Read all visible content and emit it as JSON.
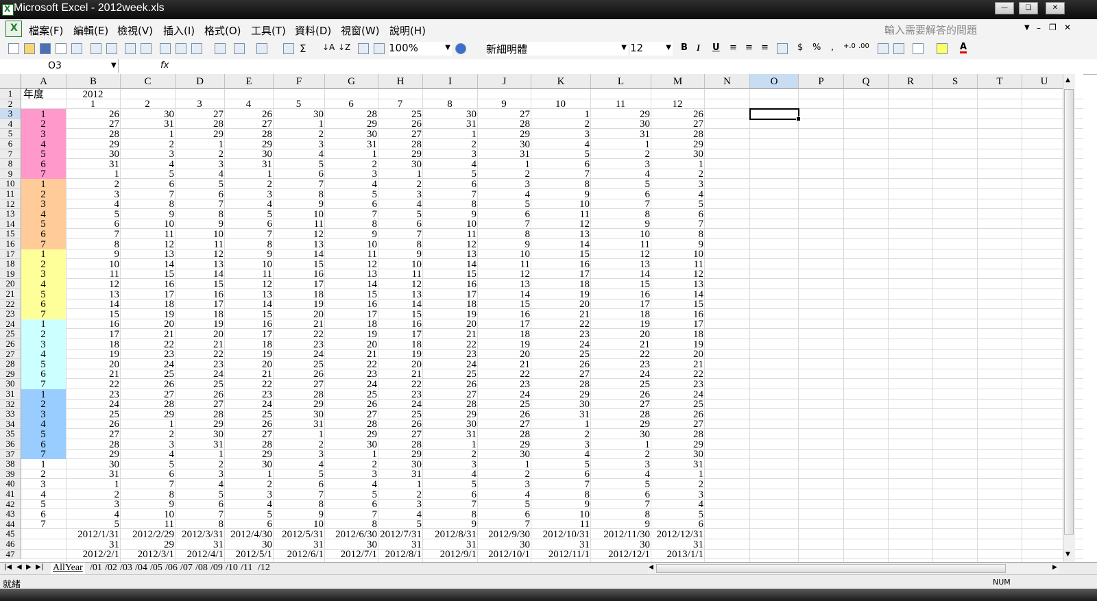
{
  "window": {
    "title": "Microsoft Excel - 2012week.xls"
  },
  "menu": {
    "items": [
      "檔案(F)",
      "編輯(E)",
      "檢視(V)",
      "插入(I)",
      "格式(O)",
      "工具(T)",
      "資料(D)",
      "視窗(W)",
      "說明(H)"
    ],
    "help_placeholder": "輸入需要解答的問題"
  },
  "toolbar": {
    "zoom": "100%",
    "font_name": "新細明體",
    "font_size": "12",
    "bold": "B",
    "italic": "I",
    "underline": "U",
    "currency": "$",
    "percent": "%",
    "comma": ","
  },
  "formula_bar": {
    "name_box": "O3",
    "fx_label": "fx",
    "content": ""
  },
  "sheet": {
    "columns": [
      "A",
      "B",
      "C",
      "D",
      "E",
      "F",
      "G",
      "H",
      "I",
      "J",
      "K",
      "L",
      "M",
      "N",
      "O",
      "P",
      "Q",
      "R",
      "S",
      "T",
      "U"
    ],
    "selected_column": "O",
    "selected_row": 3,
    "colors": {
      "pink": "#ff99cc",
      "orange": "#ffcc99",
      "yellow": "#ffff99",
      "cyan": "#ccffff",
      "blue": "#99ccff"
    },
    "row1": {
      "A": "年度",
      "B": "2012"
    },
    "row2": [
      "1",
      "2",
      "3",
      "4",
      "5",
      "6",
      "7",
      "8",
      "9",
      "10",
      "11",
      "12"
    ],
    "weekday_rows": [
      {
        "r": 3,
        "a": "1",
        "v": [
          "26",
          "30",
          "27",
          "26",
          "30",
          "28",
          "25",
          "30",
          "27",
          "1",
          "29",
          "26"
        ]
      },
      {
        "r": 4,
        "a": "2",
        "v": [
          "27",
          "31",
          "28",
          "27",
          "1",
          "29",
          "26",
          "31",
          "28",
          "2",
          "30",
          "27"
        ]
      },
      {
        "r": 5,
        "a": "3",
        "v": [
          "28",
          "1",
          "29",
          "28",
          "2",
          "30",
          "27",
          "1",
          "29",
          "3",
          "31",
          "28"
        ]
      },
      {
        "r": 6,
        "a": "4",
        "v": [
          "29",
          "2",
          "1",
          "29",
          "3",
          "31",
          "28",
          "2",
          "30",
          "4",
          "1",
          "29"
        ]
      },
      {
        "r": 7,
        "a": "5",
        "v": [
          "30",
          "3",
          "2",
          "30",
          "4",
          "1",
          "29",
          "3",
          "31",
          "5",
          "2",
          "30"
        ]
      },
      {
        "r": 8,
        "a": "6",
        "v": [
          "31",
          "4",
          "3",
          "31",
          "5",
          "2",
          "30",
          "4",
          "1",
          "6",
          "3",
          "1"
        ]
      },
      {
        "r": 9,
        "a": "7",
        "v": [
          "1",
          "5",
          "4",
          "1",
          "6",
          "3",
          "1",
          "5",
          "2",
          "7",
          "4",
          "2"
        ]
      },
      {
        "r": 10,
        "a": "1",
        "v": [
          "2",
          "6",
          "5",
          "2",
          "7",
          "4",
          "2",
          "6",
          "3",
          "8",
          "5",
          "3"
        ]
      },
      {
        "r": 11,
        "a": "2",
        "v": [
          "3",
          "7",
          "6",
          "3",
          "8",
          "5",
          "3",
          "7",
          "4",
          "9",
          "6",
          "4"
        ]
      },
      {
        "r": 12,
        "a": "3",
        "v": [
          "4",
          "8",
          "7",
          "4",
          "9",
          "6",
          "4",
          "8",
          "5",
          "10",
          "7",
          "5"
        ]
      },
      {
        "r": 13,
        "a": "4",
        "v": [
          "5",
          "9",
          "8",
          "5",
          "10",
          "7",
          "5",
          "9",
          "6",
          "11",
          "8",
          "6"
        ]
      },
      {
        "r": 14,
        "a": "5",
        "v": [
          "6",
          "10",
          "9",
          "6",
          "11",
          "8",
          "6",
          "10",
          "7",
          "12",
          "9",
          "7"
        ]
      },
      {
        "r": 15,
        "a": "6",
        "v": [
          "7",
          "11",
          "10",
          "7",
          "12",
          "9",
          "7",
          "11",
          "8",
          "13",
          "10",
          "8"
        ]
      },
      {
        "r": 16,
        "a": "7",
        "v": [
          "8",
          "12",
          "11",
          "8",
          "13",
          "10",
          "8",
          "12",
          "9",
          "14",
          "11",
          "9"
        ]
      },
      {
        "r": 17,
        "a": "1",
        "v": [
          "9",
          "13",
          "12",
          "9",
          "14",
          "11",
          "9",
          "13",
          "10",
          "15",
          "12",
          "10"
        ]
      },
      {
        "r": 18,
        "a": "2",
        "v": [
          "10",
          "14",
          "13",
          "10",
          "15",
          "12",
          "10",
          "14",
          "11",
          "16",
          "13",
          "11"
        ]
      },
      {
        "r": 19,
        "a": "3",
        "v": [
          "11",
          "15",
          "14",
          "11",
          "16",
          "13",
          "11",
          "15",
          "12",
          "17",
          "14",
          "12"
        ]
      },
      {
        "r": 20,
        "a": "4",
        "v": [
          "12",
          "16",
          "15",
          "12",
          "17",
          "14",
          "12",
          "16",
          "13",
          "18",
          "15",
          "13"
        ]
      },
      {
        "r": 21,
        "a": "5",
        "v": [
          "13",
          "17",
          "16",
          "13",
          "18",
          "15",
          "13",
          "17",
          "14",
          "19",
          "16",
          "14"
        ]
      },
      {
        "r": 22,
        "a": "6",
        "v": [
          "14",
          "18",
          "17",
          "14",
          "19",
          "16",
          "14",
          "18",
          "15",
          "20",
          "17",
          "15"
        ]
      },
      {
        "r": 23,
        "a": "7",
        "v": [
          "15",
          "19",
          "18",
          "15",
          "20",
          "17",
          "15",
          "19",
          "16",
          "21",
          "18",
          "16"
        ]
      },
      {
        "r": 24,
        "a": "1",
        "v": [
          "16",
          "20",
          "19",
          "16",
          "21",
          "18",
          "16",
          "20",
          "17",
          "22",
          "19",
          "17"
        ]
      },
      {
        "r": 25,
        "a": "2",
        "v": [
          "17",
          "21",
          "20",
          "17",
          "22",
          "19",
          "17",
          "21",
          "18",
          "23",
          "20",
          "18"
        ]
      },
      {
        "r": 26,
        "a": "3",
        "v": [
          "18",
          "22",
          "21",
          "18",
          "23",
          "20",
          "18",
          "22",
          "19",
          "24",
          "21",
          "19"
        ]
      },
      {
        "r": 27,
        "a": "4",
        "v": [
          "19",
          "23",
          "22",
          "19",
          "24",
          "21",
          "19",
          "23",
          "20",
          "25",
          "22",
          "20"
        ]
      },
      {
        "r": 28,
        "a": "5",
        "v": [
          "20",
          "24",
          "23",
          "20",
          "25",
          "22",
          "20",
          "24",
          "21",
          "26",
          "23",
          "21"
        ]
      },
      {
        "r": 29,
        "a": "6",
        "v": [
          "21",
          "25",
          "24",
          "21",
          "26",
          "23",
          "21",
          "25",
          "22",
          "27",
          "24",
          "22"
        ]
      },
      {
        "r": 30,
        "a": "7",
        "v": [
          "22",
          "26",
          "25",
          "22",
          "27",
          "24",
          "22",
          "26",
          "23",
          "28",
          "25",
          "23"
        ]
      },
      {
        "r": 31,
        "a": "1",
        "v": [
          "23",
          "27",
          "26",
          "23",
          "28",
          "25",
          "23",
          "27",
          "24",
          "29",
          "26",
          "24"
        ]
      },
      {
        "r": 32,
        "a": "2",
        "v": [
          "24",
          "28",
          "27",
          "24",
          "29",
          "26",
          "24",
          "28",
          "25",
          "30",
          "27",
          "25"
        ]
      },
      {
        "r": 33,
        "a": "3",
        "v": [
          "25",
          "29",
          "28",
          "25",
          "30",
          "27",
          "25",
          "29",
          "26",
          "31",
          "28",
          "26"
        ]
      },
      {
        "r": 34,
        "a": "4",
        "v": [
          "26",
          "1",
          "29",
          "26",
          "31",
          "28",
          "26",
          "30",
          "27",
          "1",
          "29",
          "27"
        ]
      },
      {
        "r": 35,
        "a": "5",
        "v": [
          "27",
          "2",
          "30",
          "27",
          "1",
          "29",
          "27",
          "31",
          "28",
          "2",
          "30",
          "28"
        ]
      },
      {
        "r": 36,
        "a": "6",
        "v": [
          "28",
          "3",
          "31",
          "28",
          "2",
          "30",
          "28",
          "1",
          "29",
          "3",
          "1",
          "29"
        ]
      },
      {
        "r": 37,
        "a": "7",
        "v": [
          "29",
          "4",
          "1",
          "29",
          "3",
          "1",
          "29",
          "2",
          "30",
          "4",
          "2",
          "30"
        ]
      },
      {
        "r": 38,
        "a": "1",
        "v": [
          "30",
          "5",
          "2",
          "30",
          "4",
          "2",
          "30",
          "3",
          "1",
          "5",
          "3",
          "31"
        ]
      },
      {
        "r": 39,
        "a": "2",
        "v": [
          "31",
          "6",
          "3",
          "1",
          "5",
          "3",
          "31",
          "4",
          "2",
          "6",
          "4",
          "1"
        ]
      },
      {
        "r": 40,
        "a": "3",
        "v": [
          "1",
          "7",
          "4",
          "2",
          "6",
          "4",
          "1",
          "5",
          "3",
          "7",
          "5",
          "2"
        ]
      },
      {
        "r": 41,
        "a": "4",
        "v": [
          "2",
          "8",
          "5",
          "3",
          "7",
          "5",
          "2",
          "6",
          "4",
          "8",
          "6",
          "3"
        ]
      },
      {
        "r": 42,
        "a": "5",
        "v": [
          "3",
          "9",
          "6",
          "4",
          "8",
          "6",
          "3",
          "7",
          "5",
          "9",
          "7",
          "4"
        ]
      },
      {
        "r": 43,
        "a": "6",
        "v": [
          "4",
          "10",
          "7",
          "5",
          "9",
          "7",
          "4",
          "8",
          "6",
          "10",
          "8",
          "5"
        ]
      },
      {
        "r": 44,
        "a": "7",
        "v": [
          "5",
          "11",
          "8",
          "6",
          "10",
          "8",
          "5",
          "9",
          "7",
          "11",
          "9",
          "6"
        ]
      }
    ],
    "row45": [
      "2012/1/31",
      "2012/2/29",
      "2012/3/31",
      "2012/4/30",
      "2012/5/31",
      "2012/6/30",
      "2012/7/31",
      "2012/8/31",
      "2012/9/30",
      "2012/10/31",
      "2012/11/30",
      "2012/12/31"
    ],
    "row46": [
      "31",
      "29",
      "31",
      "30",
      "31",
      "30",
      "31",
      "31",
      "30",
      "31",
      "30",
      "31"
    ],
    "row47": [
      "2012/2/1",
      "2012/3/1",
      "2012/4/1",
      "2012/5/1",
      "2012/6/1",
      "2012/7/1",
      "2012/8/1",
      "2012/9/1",
      "2012/10/1",
      "2012/11/1",
      "2012/12/1",
      "2013/1/1"
    ]
  },
  "tabs": {
    "items": [
      "AllYear",
      "01",
      "02",
      "03",
      "04",
      "05",
      "06",
      "07",
      "08",
      "09",
      "10",
      "11",
      "12"
    ],
    "active": "AllYear"
  },
  "status": {
    "ready": "就緒",
    "num": "NUM"
  }
}
